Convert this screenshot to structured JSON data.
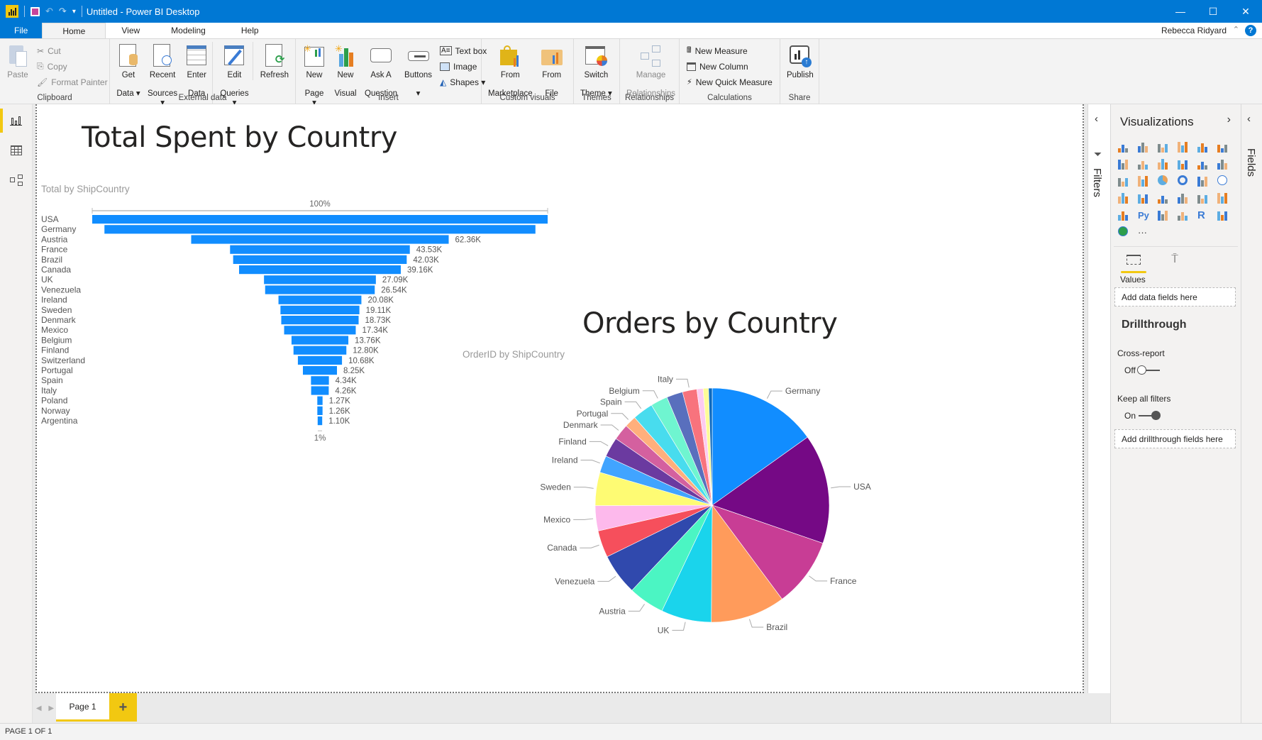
{
  "window": {
    "title": "Untitled - Power BI Desktop",
    "controls": {
      "minimize": "—",
      "maximize": "☐",
      "close": "✕"
    }
  },
  "menu_tabs": [
    {
      "label": "File"
    },
    {
      "label": "Home"
    },
    {
      "label": "View"
    },
    {
      "label": "Modeling"
    },
    {
      "label": "Help"
    }
  ],
  "user": {
    "name": "Rebecca Ridyard",
    "help": "?"
  },
  "ribbon": {
    "clipboard": {
      "label": "Clipboard",
      "paste": "Paste",
      "cut": "Cut",
      "copy": "Copy",
      "format_painter": "Format Painter"
    },
    "external_data": {
      "label": "External data",
      "get_data": [
        "Get",
        "Data ▾"
      ],
      "recent_sources": [
        "Recent",
        "Sources ▾"
      ],
      "enter_data": [
        "Enter",
        "Data"
      ],
      "edit_queries": [
        "Edit",
        "Queries ▾"
      ],
      "refresh": "Refresh"
    },
    "insert": {
      "label": "Insert",
      "new_page": [
        "New",
        "Page ▾"
      ],
      "new_visual": [
        "New",
        "Visual"
      ],
      "ask_question": [
        "Ask A",
        "Question"
      ],
      "buttons": [
        "Buttons",
        "▾"
      ],
      "text_box": "Text box",
      "image": "Image",
      "shapes": "Shapes ▾"
    },
    "custom_visuals": {
      "label": "Custom visuals",
      "from_marketplace": [
        "From",
        "Marketplace"
      ],
      "from_file": [
        "From",
        "File"
      ]
    },
    "themes": {
      "label": "Themes",
      "switch_theme": [
        "Switch",
        "Theme ▾"
      ]
    },
    "relationships": {
      "label": "Relationships",
      "manage": [
        "Manage",
        "Relationships"
      ]
    },
    "calculations": {
      "label": "Calculations",
      "new_measure": "New Measure",
      "new_column": "New Column",
      "new_quick_measure": "New Quick Measure"
    },
    "share": {
      "label": "Share",
      "publish": "Publish"
    }
  },
  "left_nav": [
    {
      "name": "report-view"
    },
    {
      "name": "data-view"
    },
    {
      "name": "model-view"
    }
  ],
  "filters_pane": {
    "label": "Filters",
    "collapse": "‹"
  },
  "visualizations_pane": {
    "title": "Visualizations",
    "expand": "›",
    "more": "···",
    "values_label": "Values",
    "values_placeholder": "Add data fields here",
    "drillthrough_title": "Drillthrough",
    "cross_report_label": "Cross-report",
    "cross_report_state": "Off",
    "keep_filters_label": "Keep all filters",
    "keep_filters_state": "On",
    "drillthrough_placeholder": "Add drillthrough fields here"
  },
  "fields_pane": {
    "label": "Fields",
    "collapse": "‹"
  },
  "pages": {
    "tabs": [
      {
        "label": "Page 1"
      }
    ],
    "add": "+",
    "status": "PAGE 1 OF 1"
  },
  "report": {
    "funnel_title": "Total Spent by Country",
    "funnel_subtitle": "Total by ShipCountry",
    "pie_title": "Orders by Country",
    "pie_subtitle": "OrderID by ShipCountry"
  },
  "chart_data": [
    {
      "type": "bar",
      "subtype": "funnel",
      "title": "Total Spent by Country",
      "subtitle": "Total by ShipCountry",
      "top_label": "100%",
      "bottom_label": "1%",
      "color": "#118dff",
      "categories": [
        "USA",
        "Germany",
        "Austria",
        "France",
        "Brazil",
        "Canada",
        "UK",
        "Venezuela",
        "Ireland",
        "Sweden",
        "Denmark",
        "Mexico",
        "Belgium",
        "Finland",
        "Switzerland",
        "Portugal",
        "Spain",
        "Italy",
        "Poland",
        "Norway",
        "Argentina"
      ],
      "values": [
        110280,
        104360,
        62360,
        43530,
        42030,
        39160,
        27090,
        26540,
        20080,
        19110,
        18730,
        17340,
        13760,
        12800,
        10680,
        8250,
        4340,
        4260,
        1270,
        1260,
        1100
      ],
      "data_labels": [
        "",
        "",
        "62.36K",
        "43.53K",
        "42.03K",
        "39.16K",
        "27.09K",
        "26.54K",
        "20.08K",
        "19.11K",
        "18.73K",
        "17.34K",
        "13.76K",
        "12.80K",
        "10.68K",
        "8.25K",
        "4.34K",
        "4.26K",
        "1.27K",
        "1.26K",
        "1.10K"
      ]
    },
    {
      "type": "pie",
      "title": "Orders by Country",
      "subtitle": "OrderID by ShipCountry",
      "slices": [
        {
          "label": "Germany",
          "value": 122,
          "color": "#118dff",
          "show_label": true
        },
        {
          "label": "USA",
          "value": 122,
          "color": "#750985",
          "show_label": true
        },
        {
          "label": "France",
          "value": 77,
          "color": "#c83d95",
          "show_label": true
        },
        {
          "label": "Brazil",
          "value": 83,
          "color": "#ff9b5b",
          "show_label": true
        },
        {
          "label": "UK",
          "value": 56,
          "color": "#1ad4ec",
          "show_label": true
        },
        {
          "label": "Austria",
          "value": 40,
          "color": "#4bf5c3",
          "show_label": true
        },
        {
          "label": "Venezuela",
          "value": 46,
          "color": "#3049ad",
          "show_label": true
        },
        {
          "label": "Canada",
          "value": 30,
          "color": "#f64f5c",
          "show_label": true
        },
        {
          "label": "Mexico",
          "value": 28,
          "color": "#fdb9ec",
          "show_label": true
        },
        {
          "label": "Sweden",
          "value": 37,
          "color": "#fefb73",
          "show_label": true
        },
        {
          "label": "Ireland",
          "value": 19,
          "color": "#41a4ff",
          "show_label": true
        },
        {
          "label": "Finland",
          "value": 22,
          "color": "#6b3aa0",
          "show_label": true
        },
        {
          "label": "Denmark",
          "value": 18,
          "color": "#d4609f",
          "show_label": true
        },
        {
          "label": "Portugal",
          "value": 13,
          "color": "#ffaf7c",
          "show_label": true
        },
        {
          "label": "Spain",
          "value": 23,
          "color": "#48dcee",
          "show_label": true
        },
        {
          "label": "Belgium",
          "value": 19,
          "color": "#6ff5d0",
          "show_label": true
        },
        {
          "label": "Switzerland",
          "value": 18,
          "color": "#596fbd",
          "show_label": false
        },
        {
          "label": "Italy",
          "value": 16,
          "color": "#f8737d",
          "show_label": true
        },
        {
          "label": "Argentina",
          "value": 7,
          "color": "#fdcbf0",
          "show_label": false
        },
        {
          "label": "Poland",
          "value": 6,
          "color": "#fefc96",
          "show_label": false
        },
        {
          "label": "Norway",
          "value": 4,
          "color": "#0d6abf",
          "show_label": false
        }
      ]
    }
  ]
}
